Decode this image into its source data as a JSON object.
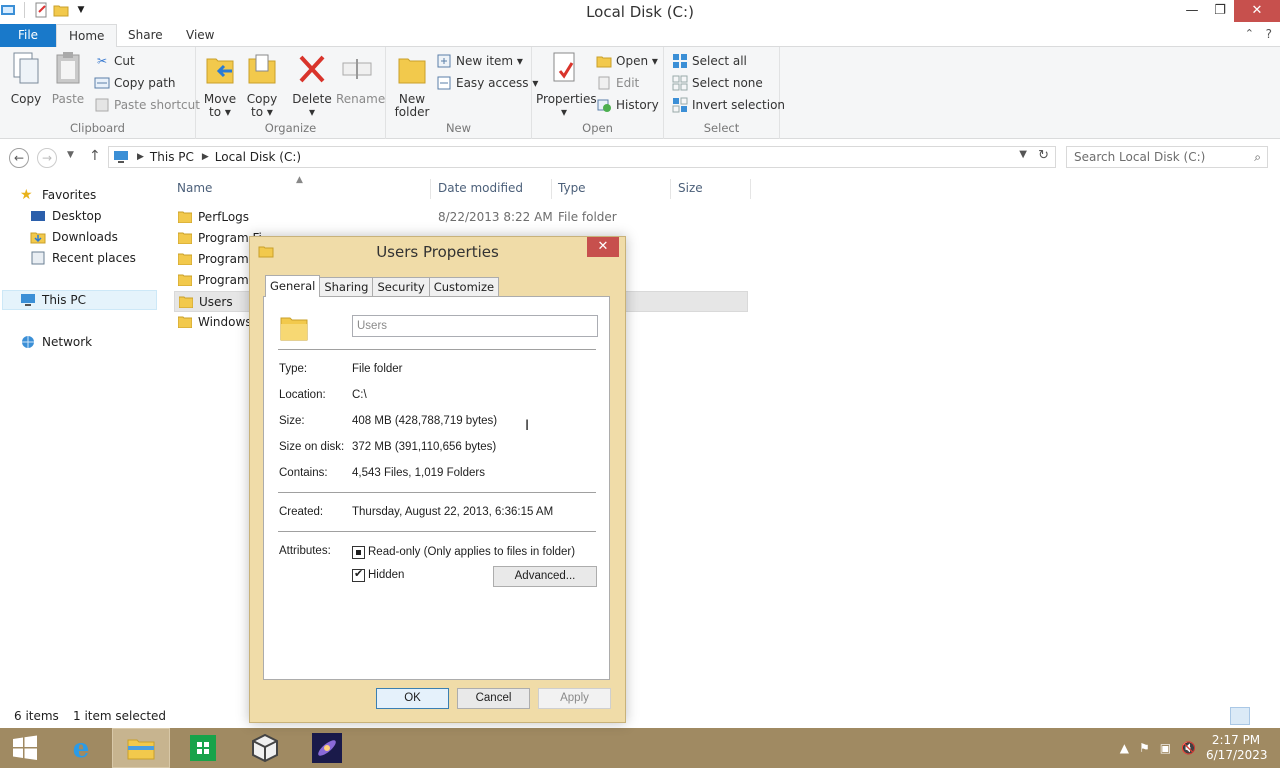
{
  "window": {
    "title": "Local Disk (C:)",
    "controls": {
      "minimize": "—",
      "maximize": "❐",
      "close": "✕"
    }
  },
  "ribbon_tabs": {
    "file": "File",
    "home": "Home",
    "share": "Share",
    "view": "View"
  },
  "ribbon": {
    "clipboard": {
      "label": "Clipboard",
      "copy": "Copy",
      "paste": "Paste",
      "cut": "Cut",
      "copy_path": "Copy path",
      "paste_shortcut": "Paste shortcut"
    },
    "organize": {
      "label": "Organize",
      "move_to": [
        "Move",
        "to ▾"
      ],
      "copy_to": [
        "Copy",
        "to ▾"
      ],
      "delete": [
        "Delete",
        "▾"
      ],
      "rename": "Rename"
    },
    "new": {
      "label": "New",
      "new_folder": [
        "New",
        "folder"
      ],
      "new_item": "New item ▾",
      "easy_access": "Easy access ▾"
    },
    "open": {
      "label": "Open",
      "properties": [
        "Properties",
        "▾"
      ],
      "open": "Open ▾",
      "edit": "Edit",
      "history": "History"
    },
    "select": {
      "label": "Select",
      "select_all": "Select all",
      "select_none": "Select none",
      "invert_selection": "Invert selection"
    }
  },
  "address": {
    "crumbs": [
      "This PC",
      "Local Disk (C:)"
    ],
    "search_placeholder": "Search Local Disk (C:)"
  },
  "nav": {
    "favorites": "Favorites",
    "desktop": "Desktop",
    "downloads": "Downloads",
    "recent_places": "Recent places",
    "this_pc": "This PC",
    "network": "Network"
  },
  "columns": {
    "name": "Name",
    "date_modified": "Date modified",
    "type": "Type",
    "size": "Size"
  },
  "files": [
    {
      "name": "PerfLogs",
      "date": "8/22/2013 8:22 AM",
      "type": "File folder"
    },
    {
      "name": "Program Fi",
      "date": "",
      "type": ""
    },
    {
      "name": "Program I",
      "date": "",
      "type": ""
    },
    {
      "name": "ProgramD",
      "date": "",
      "type": ""
    },
    {
      "name": "Users",
      "date": "",
      "type": ""
    },
    {
      "name": "Windows",
      "date": "",
      "type": ""
    }
  ],
  "status": {
    "count": "6 items",
    "selected": "1 item selected"
  },
  "taskbar": {
    "time": "2:17 PM",
    "date": "6/17/2023"
  },
  "dialog": {
    "title": "Users Properties",
    "tabs": [
      "General",
      "Sharing",
      "Security",
      "Customize"
    ],
    "name_value": "Users",
    "type_label": "Type:",
    "type_value": "File folder",
    "location_label": "Location:",
    "location_value": "C:\\",
    "size_label": "Size:",
    "size_value": "408 MB (428,788,719 bytes)",
    "size_on_disk_label": "Size on disk:",
    "size_on_disk_value": "372 MB (391,110,656 bytes)",
    "contains_label": "Contains:",
    "contains_value": "4,543 Files, 1,019 Folders",
    "created_label": "Created:",
    "created_value": "Thursday, August 22, 2013, 6:36:15 AM",
    "attributes_label": "Attributes:",
    "readonly_label": "Read-only (Only applies to files in folder)",
    "hidden_label": "Hidden",
    "advanced_button": "Advanced...",
    "ok_button": "OK",
    "cancel_button": "Cancel",
    "apply_button": "Apply"
  },
  "colors": {
    "file_tab": "#1979ca",
    "dialog_frame": "#f0dca8",
    "taskbar": "#a08a62",
    "close_button": "#c7504d"
  }
}
